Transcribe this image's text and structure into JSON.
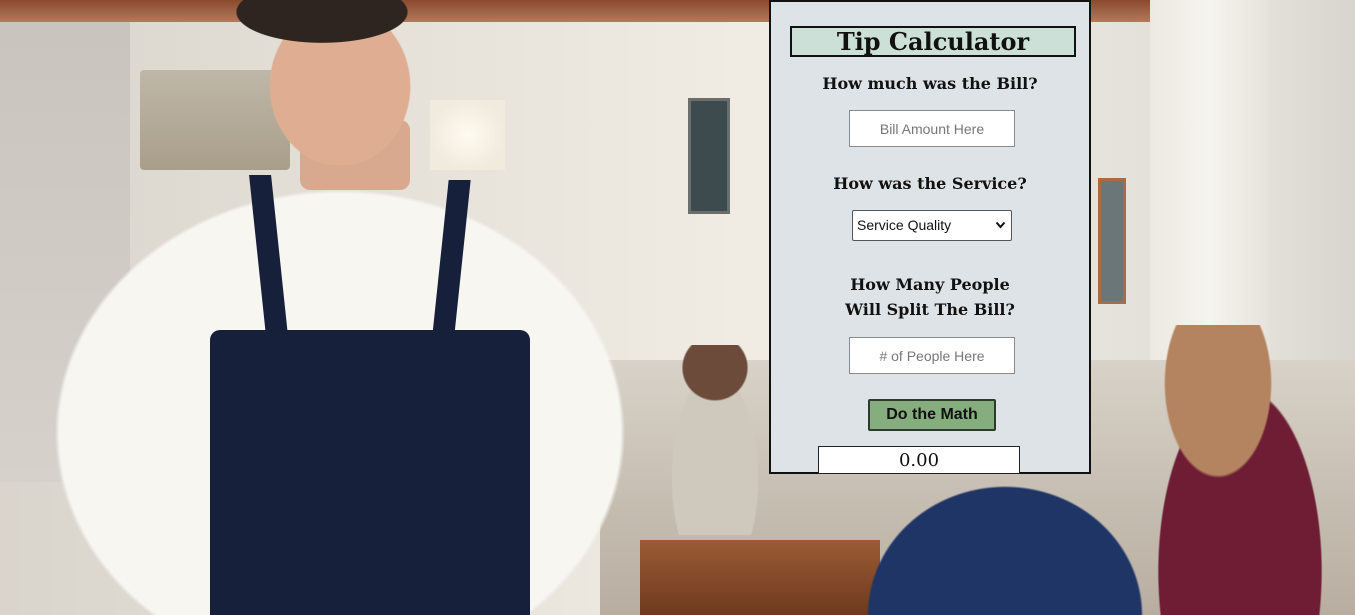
{
  "calculator": {
    "title": "Tip Calculator",
    "bill_question": "How much was the Bill?",
    "bill_placeholder": "Bill Amount Here",
    "service_question": "How was the Service?",
    "service_selected": "Service Quality",
    "people_question_line1": "How Many People",
    "people_question_line2": "Will Split The Bill?",
    "people_placeholder": "# of People Here",
    "calculate_button": "Do the Math",
    "result": "0.00"
  },
  "colors": {
    "card_background": "#dde3e6",
    "title_background": "#cde0d8",
    "button_background": "#86ad7e"
  },
  "icons": {
    "select_arrow": "chevron-down-icon"
  }
}
